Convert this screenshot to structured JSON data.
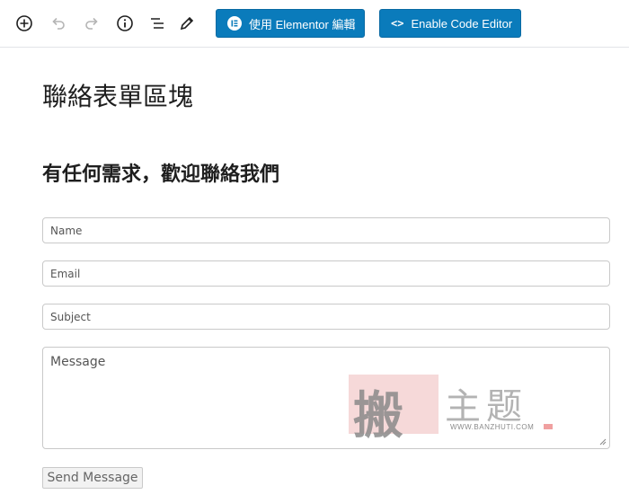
{
  "toolbar": {
    "icons": [
      "add-block-icon",
      "undo-icon",
      "redo-icon",
      "info-icon",
      "list-view-icon",
      "edit-icon"
    ],
    "elementor_label": "使用 Elementor 編輯",
    "code_editor_label": "Enable Code Editor",
    "accent": "#0a7bbb"
  },
  "content": {
    "page_title": "聯絡表單區塊",
    "subtitle": "有任何需求，歡迎聯絡我們",
    "form": {
      "name_placeholder": "Name",
      "email_placeholder": "Email",
      "subject_placeholder": "Subject",
      "message_placeholder": "Message",
      "submit_label": "Send Message"
    }
  },
  "watermark": {
    "stamp_char": "搬",
    "text": "主题",
    "url": "WWW.BANZHUTI.COM"
  }
}
